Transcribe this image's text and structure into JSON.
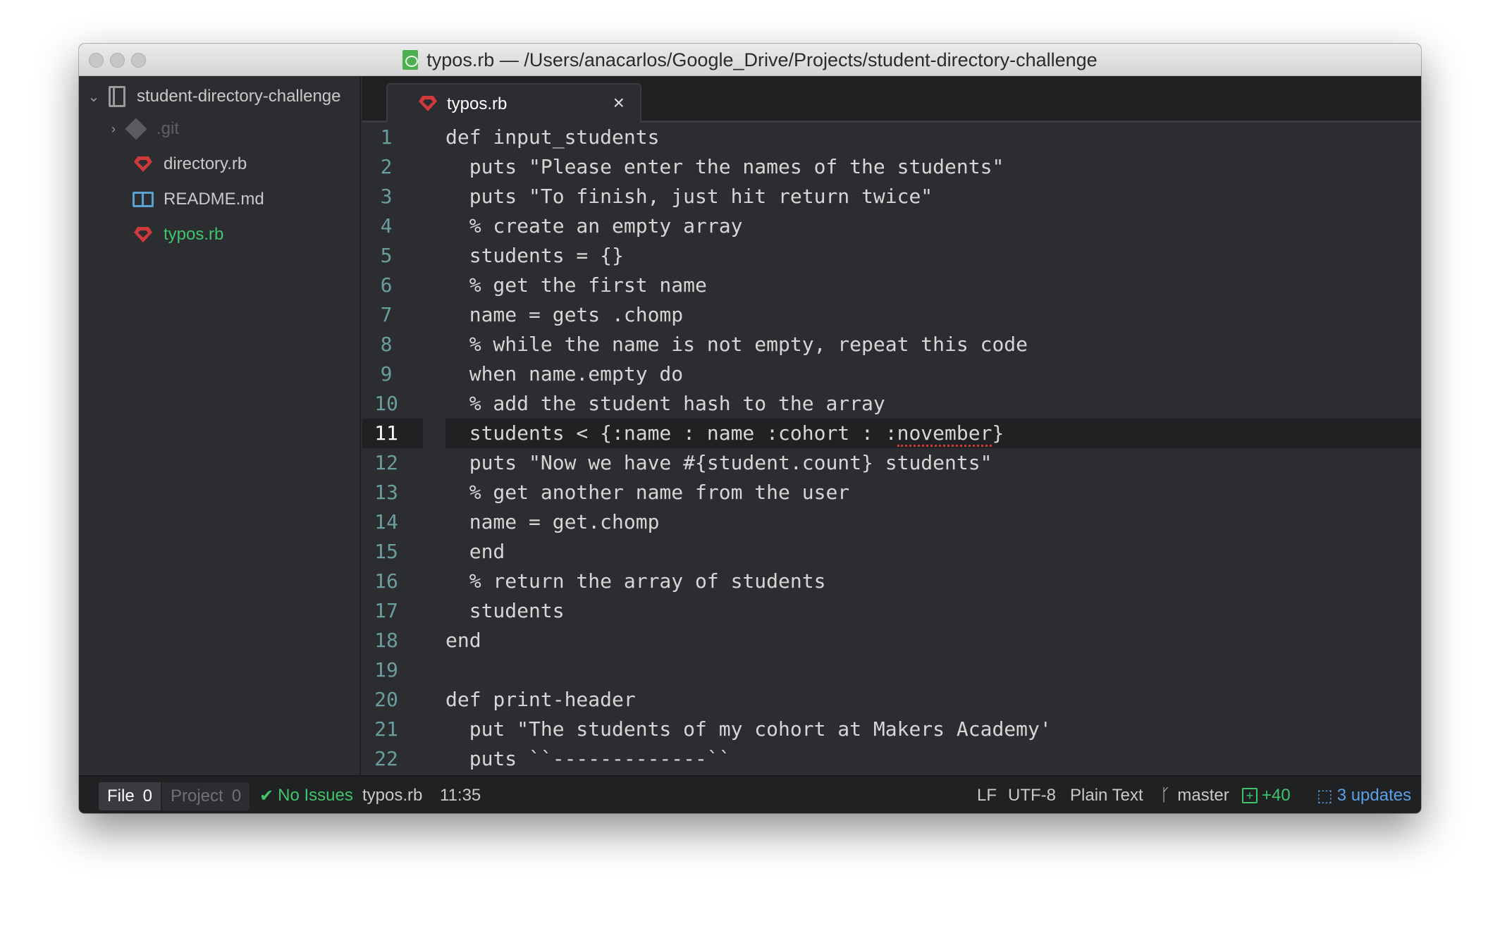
{
  "window": {
    "title": "typos.rb — /Users/anacarlos/Google_Drive/Projects/student-directory-challenge"
  },
  "sidebar": {
    "project_name": "student-directory-challenge",
    "items": [
      {
        "label": ".git",
        "icon": "git-folder-icon",
        "color": "#5e6064"
      },
      {
        "label": "directory.rb",
        "icon": "ruby-icon",
        "color": "#c9c9c9"
      },
      {
        "label": "README.md",
        "icon": "book-icon",
        "color": "#c9c9c9"
      },
      {
        "label": "typos.rb",
        "icon": "ruby-icon",
        "color": "#3fc56b"
      }
    ]
  },
  "tab": {
    "label": "typos.rb",
    "close_glyph": "×"
  },
  "editor": {
    "active_line": 11,
    "lines": [
      {
        "num": "1",
        "text": "def input_students"
      },
      {
        "num": "2",
        "text": "  puts \"Please enter the names of the students\""
      },
      {
        "num": "3",
        "text": "  puts \"To finish, just hit return twice\""
      },
      {
        "num": "4",
        "text": "  % create an empty array"
      },
      {
        "num": "5",
        "text": "  students = {}"
      },
      {
        "num": "6",
        "text": "  % get the first name"
      },
      {
        "num": "7",
        "text": "  name = gets .chomp"
      },
      {
        "num": "8",
        "text": "  % while the name is not empty, repeat this code"
      },
      {
        "num": "9",
        "text": "  when name.empty do"
      },
      {
        "num": "10",
        "text": "  % add the student hash to the array"
      },
      {
        "num": "11",
        "text": "  students < {:name : name :cohort : :",
        "squiggle": "november",
        "after": "}"
      },
      {
        "num": "12",
        "text": "  puts \"Now we have #{student.count} students\""
      },
      {
        "num": "13",
        "text": "  % get another name from the user"
      },
      {
        "num": "14",
        "text": "  name = get.chomp"
      },
      {
        "num": "15",
        "text": "  end"
      },
      {
        "num": "16",
        "text": "  % return the array of students"
      },
      {
        "num": "17",
        "text": "  students"
      },
      {
        "num": "18",
        "text": "end"
      },
      {
        "num": "19",
        "text": ""
      },
      {
        "num": "20",
        "text": "def print-header"
      },
      {
        "num": "21",
        "text": "  put \"The students of my cohort at Makers Academy'"
      },
      {
        "num": "22",
        "text": "  puts ``-------------``"
      }
    ]
  },
  "statusbar": {
    "file_label": "File",
    "file_count": "0",
    "project_label": "Project",
    "project_count": "0",
    "issues": "No Issues",
    "filename": "typos.rb",
    "cursor": "11:35",
    "line_ending": "LF",
    "encoding": "UTF-8",
    "grammar": "Plain Text",
    "branch": "master",
    "diff": "+40",
    "updates": "3 updates"
  }
}
